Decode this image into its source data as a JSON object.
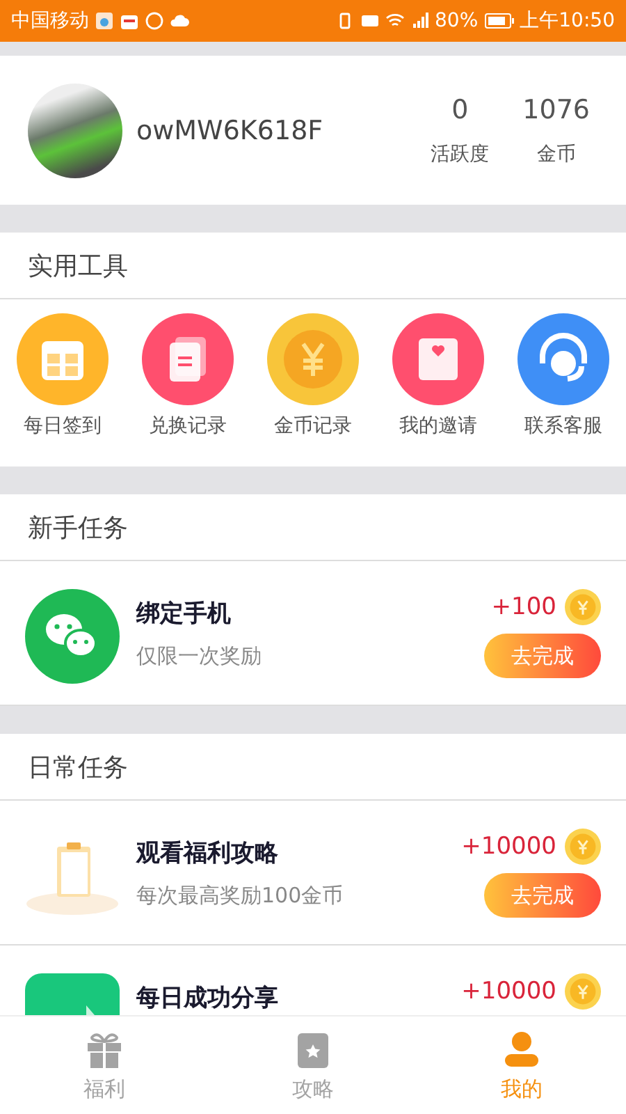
{
  "status_bar": {
    "carrier": "中国移动",
    "battery": "80%",
    "time": "上午10:50"
  },
  "profile": {
    "username": "owMW6K618F",
    "stats": [
      {
        "value": "0",
        "label": "活跃度"
      },
      {
        "value": "1076",
        "label": "金币"
      }
    ]
  },
  "tools": {
    "title": "实用工具",
    "items": [
      {
        "kind": "calendar",
        "label": "每日签到"
      },
      {
        "kind": "document",
        "label": "兑换记录"
      },
      {
        "kind": "coin",
        "label": "金币记录"
      },
      {
        "kind": "envelope",
        "label": "我的邀请"
      },
      {
        "kind": "headset",
        "label": "联系客服"
      }
    ]
  },
  "task_sections": [
    {
      "title": "新手任务",
      "tasks": [
        {
          "kind": "wechat",
          "title": "绑定手机",
          "subtitle": "仅限一次奖励",
          "reward": "+100",
          "action": "去完成"
        }
      ]
    },
    {
      "title": "日常任务",
      "tasks": [
        {
          "kind": "clipboard",
          "title": "观看福利攻略",
          "subtitle": "每次最高奖励100金币",
          "reward": "+10000",
          "action": "去完成"
        },
        {
          "kind": "share",
          "title": "每日成功分享",
          "reward": "+10000"
        }
      ]
    }
  ],
  "tab_bar": [
    {
      "kind": "gift",
      "label": "福利",
      "selected": false
    },
    {
      "kind": "guide",
      "label": "攻略",
      "selected": false
    },
    {
      "kind": "person",
      "label": "我的",
      "selected": true
    }
  ]
}
